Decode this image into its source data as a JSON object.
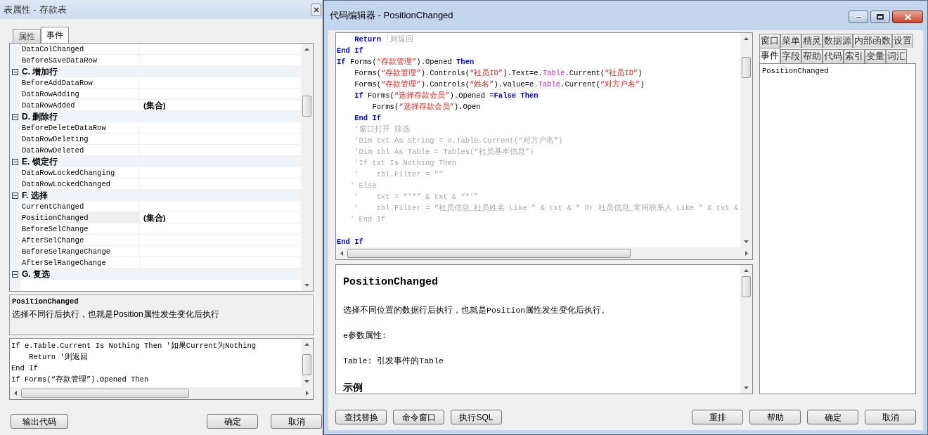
{
  "table_window": {
    "title": "表属性 - 存款表",
    "tabs": [
      {
        "label": "属性",
        "selected": false
      },
      {
        "label": "事件",
        "selected": true
      }
    ],
    "grid_rows": [
      {
        "kind": "property",
        "name": "DataColChanged",
        "selected": false
      },
      {
        "kind": "property",
        "name": "BeforeSaveDataRow",
        "selected": false
      },
      {
        "kind": "category",
        "name": "C. 增加行",
        "expanded": true
      },
      {
        "kind": "property",
        "name": "BeforeAddDataRow",
        "selected": false
      },
      {
        "kind": "property",
        "name": "DataRowAdding",
        "selected": false
      },
      {
        "kind": "property",
        "name": "DataRowAdded",
        "value": "(集合)",
        "selected": false
      },
      {
        "kind": "category",
        "name": "D. 删除行",
        "expanded": true
      },
      {
        "kind": "property",
        "name": "BeforeDeleteDataRow",
        "selected": false
      },
      {
        "kind": "property",
        "name": "DataRowDeleting",
        "selected": false
      },
      {
        "kind": "property",
        "name": "DataRowDeleted",
        "selected": false
      },
      {
        "kind": "category",
        "name": "E. 锁定行",
        "expanded": true
      },
      {
        "kind": "property",
        "name": "DataRowLockedChanging",
        "selected": false
      },
      {
        "kind": "property",
        "name": "DataRowLockedChanged",
        "selected": false
      },
      {
        "kind": "category",
        "name": "F. 选择",
        "expanded": true
      },
      {
        "kind": "property",
        "name": "CurrentChanged",
        "selected": false
      },
      {
        "kind": "property",
        "name": "PositionChanged",
        "value": "(集合)",
        "selected": true
      },
      {
        "kind": "property",
        "name": "BeforeSelChange",
        "selected": false
      },
      {
        "kind": "property",
        "name": "AfterSelChange",
        "selected": false
      },
      {
        "kind": "property",
        "name": "BeforeSelRangeChange",
        "selected": false
      },
      {
        "kind": "property",
        "name": "AfterSelRangeChange",
        "selected": false
      },
      {
        "kind": "category",
        "name": "G. 复选",
        "expanded": true
      }
    ],
    "description": {
      "title": "PositionChanged",
      "text": "选择不同行后执行，也就是Position属性发生变化后执行"
    },
    "code_lines": [
      "If e.Table.Current Is Nothing Then '如果Current为Nothing",
      "    Return '则返回",
      "End If",
      "If Forms(“存款管理”).Opened Then"
    ],
    "buttons": {
      "left": [
        "输出代码"
      ],
      "right": [
        "确定",
        "取消"
      ]
    }
  },
  "code_window": {
    "title": "代码编辑器 - PositionChanged",
    "code_lines": [
      {
        "tokens": [
          {
            "kind": "keyword",
            "text": "    Return"
          },
          {
            "kind": "comment",
            "text": " '则返回"
          }
        ]
      },
      {
        "tokens": [
          {
            "kind": "keyword",
            "text": "End If"
          }
        ]
      },
      {
        "tokens": [
          {
            "kind": "keyword",
            "text": "If"
          },
          {
            "kind": "plain",
            "text": " Forms("
          },
          {
            "kind": "string",
            "text": "“存款管理”"
          },
          {
            "kind": "plain",
            "text": ").Opened "
          },
          {
            "kind": "keyword",
            "text": "Then"
          }
        ]
      },
      {
        "tokens": [
          {
            "kind": "plain",
            "text": "    Forms("
          },
          {
            "kind": "string",
            "text": "“存款管理”"
          },
          {
            "kind": "plain",
            "text": ").Controls("
          },
          {
            "kind": "string",
            "text": "“社员ID”"
          },
          {
            "kind": "plain",
            "text": ").Text=e."
          },
          {
            "kind": "member",
            "text": "Table"
          },
          {
            "kind": "plain",
            "text": ".Current("
          },
          {
            "kind": "string",
            "text": "“社员ID”"
          },
          {
            "kind": "plain",
            "text": ")"
          }
        ]
      },
      {
        "tokens": [
          {
            "kind": "plain",
            "text": "    Forms("
          },
          {
            "kind": "string",
            "text": "“存款管理”"
          },
          {
            "kind": "plain",
            "text": ").Controls("
          },
          {
            "kind": "string",
            "text": "“姓名”"
          },
          {
            "kind": "plain",
            "text": ").value=e."
          },
          {
            "kind": "member",
            "text": "Table"
          },
          {
            "kind": "plain",
            "text": ".Current("
          },
          {
            "kind": "string",
            "text": "“对方户名”"
          },
          {
            "kind": "plain",
            "text": ")"
          }
        ]
      },
      {
        "tokens": [
          {
            "kind": "keyword",
            "text": "    If"
          },
          {
            "kind": "plain",
            "text": " Forms("
          },
          {
            "kind": "string",
            "text": "“选择存款会员”"
          },
          {
            "kind": "plain",
            "text": ").Opened ="
          },
          {
            "kind": "keyword",
            "text": "False Then"
          }
        ]
      },
      {
        "tokens": [
          {
            "kind": "plain",
            "text": "        Forms("
          },
          {
            "kind": "string",
            "text": "“选择存款会员”"
          },
          {
            "kind": "plain",
            "text": ").Open"
          }
        ]
      },
      {
        "tokens": [
          {
            "kind": "keyword",
            "text": "    End If"
          }
        ]
      },
      {
        "tokens": [
          {
            "kind": "comment",
            "text": "    '窗口打开 筛选"
          }
        ]
      },
      {
        "tokens": [
          {
            "kind": "comment",
            "text": "    'Dim txt As String = e.Table.Current(“对方户名”)"
          }
        ]
      },
      {
        "tokens": [
          {
            "kind": "comment",
            "text": "    'Dim tbl As Table = Tables(“社员基本信息”)"
          }
        ]
      },
      {
        "tokens": [
          {
            "kind": "comment",
            "text": "    'If txt Is Nothing Then"
          }
        ]
      },
      {
        "tokens": [
          {
            "kind": "comment",
            "text": "    '    tbl.Filter = “”"
          }
        ]
      },
      {
        "tokens": [
          {
            "kind": "comment",
            "text": "   ' Else"
          }
        ]
      },
      {
        "tokens": [
          {
            "kind": "comment",
            "text": "    '    txt = “'*” & txt & “*'”"
          }
        ]
      },
      {
        "tokens": [
          {
            "kind": "comment",
            "text": "    '    tbl.Filter = “社员信息_社员姓名 Like ” & txt & “ Or 社员信息_常用联系人 Like ” & txt &"
          }
        ]
      },
      {
        "tokens": [
          {
            "kind": "comment",
            "text": "   ' End If"
          }
        ]
      },
      {
        "blank_before": true,
        "tokens": [
          {
            "kind": "keyword",
            "text": "End If"
          }
        ]
      }
    ],
    "help": [
      {
        "kind": "title",
        "text": "PositionChanged"
      },
      {
        "kind": "text",
        "text": "选择不同位置的数据行后执行，也就是Position属性发生变化后执行。"
      },
      {
        "kind": "text",
        "text": "e参数属性:"
      },
      {
        "kind": "text",
        "text": "Table: 引发事件的Table"
      },
      {
        "kind": "heading",
        "text": "示例"
      }
    ],
    "tab_rows": [
      [
        {
          "label": "窗口",
          "selected": false
        },
        {
          "label": "菜单",
          "selected": false
        },
        {
          "label": "精灵",
          "selected": false
        },
        {
          "label": "数据源",
          "selected": false
        },
        {
          "label": "内部函数",
          "selected": false
        },
        {
          "label": "设置",
          "selected": false
        }
      ],
      [
        {
          "label": "事件",
          "selected": true
        },
        {
          "label": "字段",
          "selected": false
        },
        {
          "label": "帮助",
          "selected": false
        },
        {
          "label": "代码",
          "selected": false
        },
        {
          "label": "索引",
          "selected": false
        },
        {
          "label": "变量",
          "selected": false
        },
        {
          "label": "词汇",
          "selected": false
        }
      ]
    ],
    "event_list": [
      "PositionChanged"
    ],
    "buttons": {
      "left": [
        "查找替换",
        "命令窗口",
        "执行SQL"
      ],
      "right": [
        "重排",
        "帮助",
        "确定",
        "取消"
      ]
    }
  }
}
